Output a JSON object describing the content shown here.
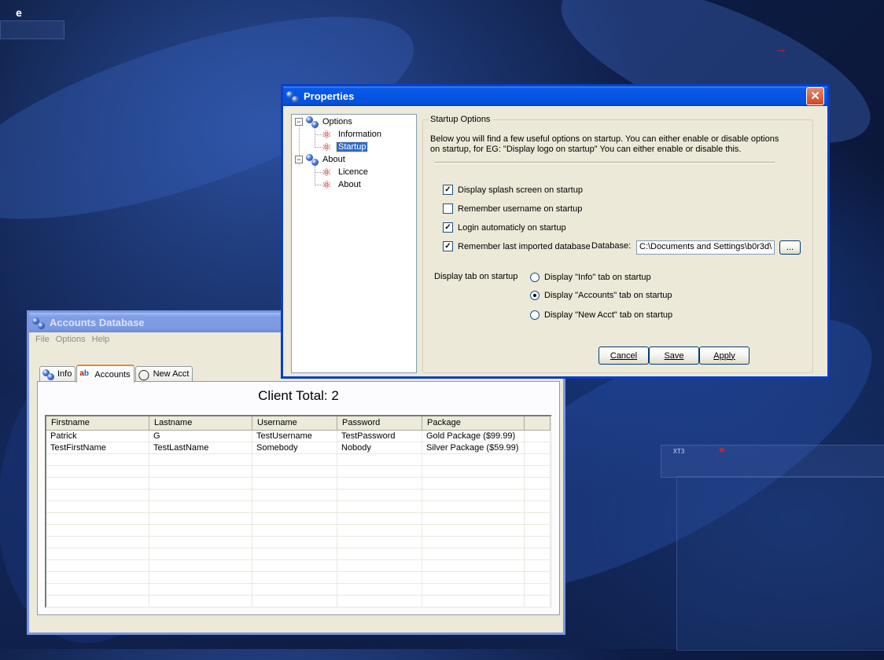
{
  "desktop": {
    "corner_text": "e",
    "xt_label": "XT3"
  },
  "properties": {
    "title": "Properties",
    "tree": [
      {
        "label": "Options",
        "children": [
          "Information",
          "Startup"
        ]
      },
      {
        "label": "About",
        "children": [
          "Licence",
          "About"
        ]
      }
    ],
    "tree_labels": {
      "options": "Options",
      "information": "Information",
      "startup": "Startup",
      "about_group": "About",
      "licence": "Licence",
      "about_item": "About"
    },
    "selected_node": "Startup",
    "group_title": "Startup Options",
    "description_line1": "Below you will find a few useful options on startup.  You can either enable or disable options",
    "description_line2": "on startup, for EG:  \"Display logo on startup\"  You can either enable or disable this.",
    "options": {
      "splash": {
        "label": "Display splash screen on startup",
        "checked": true
      },
      "remember_user": {
        "label": "Remember username on startup",
        "checked": false
      },
      "auto_login": {
        "label": "Login automaticly on startup",
        "checked": true
      },
      "remember_db": {
        "label": "Remember last imported database",
        "checked": true
      }
    },
    "database_label": "Database:",
    "database_value": "C:\\Documents and Settings\\b0r3d\\",
    "browse_label": "...",
    "tab_startup_label": "Display tab on startup",
    "tab_options": {
      "info": {
        "label": "Display \"Info\" tab on startup",
        "selected": false
      },
      "accounts": {
        "label": "Display \"Accounts\" tab on startup",
        "selected": true
      },
      "newacct": {
        "label": "Display \"New Acct\" tab on startup",
        "selected": false
      }
    },
    "buttons": {
      "cancel": "Cancel",
      "save": "Save",
      "apply": "Apply"
    }
  },
  "accounts_window": {
    "title": "Accounts Database",
    "menu": {
      "file": "File",
      "options": "Options",
      "help": "Help"
    },
    "tabs": {
      "info": "Info",
      "accounts": "Accounts",
      "new_acct": "New Acct"
    },
    "active_tab": "Accounts",
    "client_total": "Client Total: 2",
    "table": {
      "columns": [
        "Firstname",
        "Lastname",
        "Username",
        "Password",
        "Package"
      ],
      "rows": [
        [
          "Patrick",
          "G",
          "TestUsername",
          "TestPassword",
          "Gold Package ($99.99)"
        ],
        [
          "TestFirstName",
          "TestLastName",
          "Somebody",
          "Nobody",
          "Silver Package ($59.99)"
        ]
      ]
    }
  },
  "colors": {
    "title_active": "#0554e3",
    "title_inactive": "#7b99e1",
    "dialog_face": "#ece9d8",
    "selection": "#316ac5",
    "close_button": "#d1461f"
  }
}
